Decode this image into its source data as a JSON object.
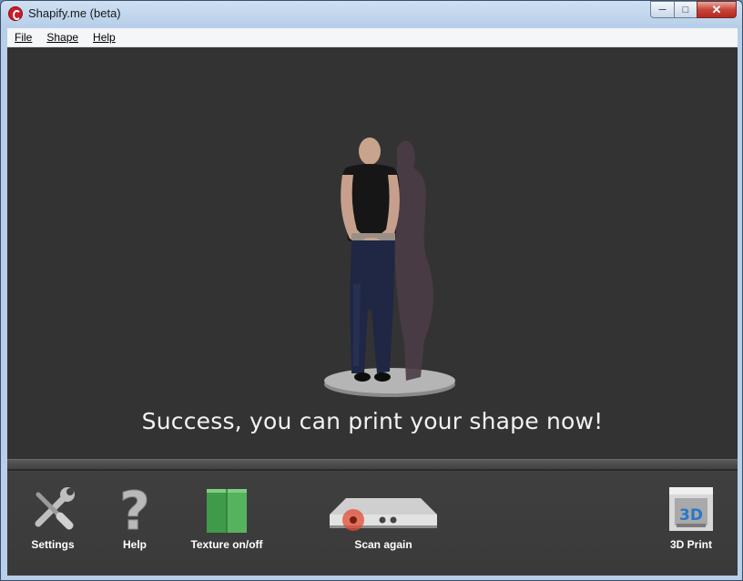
{
  "window": {
    "title": "Shapify.me (beta)"
  },
  "menu": {
    "file": "File",
    "shape": "Shape",
    "help": "Help"
  },
  "viewport": {
    "status_message": "Success, you can print your shape now!"
  },
  "toolbar": {
    "settings_label": "Settings",
    "help_label": "Help",
    "texture_label": "Texture on/off",
    "scan_label": "Scan again",
    "print_label": "3D Print",
    "print_icon_text": "3D"
  },
  "icons": [
    "app-icon",
    "wrench-screwdriver-icon",
    "question-mark-icon",
    "texture-cube-icon",
    "kinect-sensor-icon",
    "3d-printer-icon"
  ],
  "colors": {
    "viewport_bg": "#333333",
    "toolbar_bg": "#3a3a3a",
    "status_text": "#f2f2f2",
    "close_button": "#c7453a"
  }
}
